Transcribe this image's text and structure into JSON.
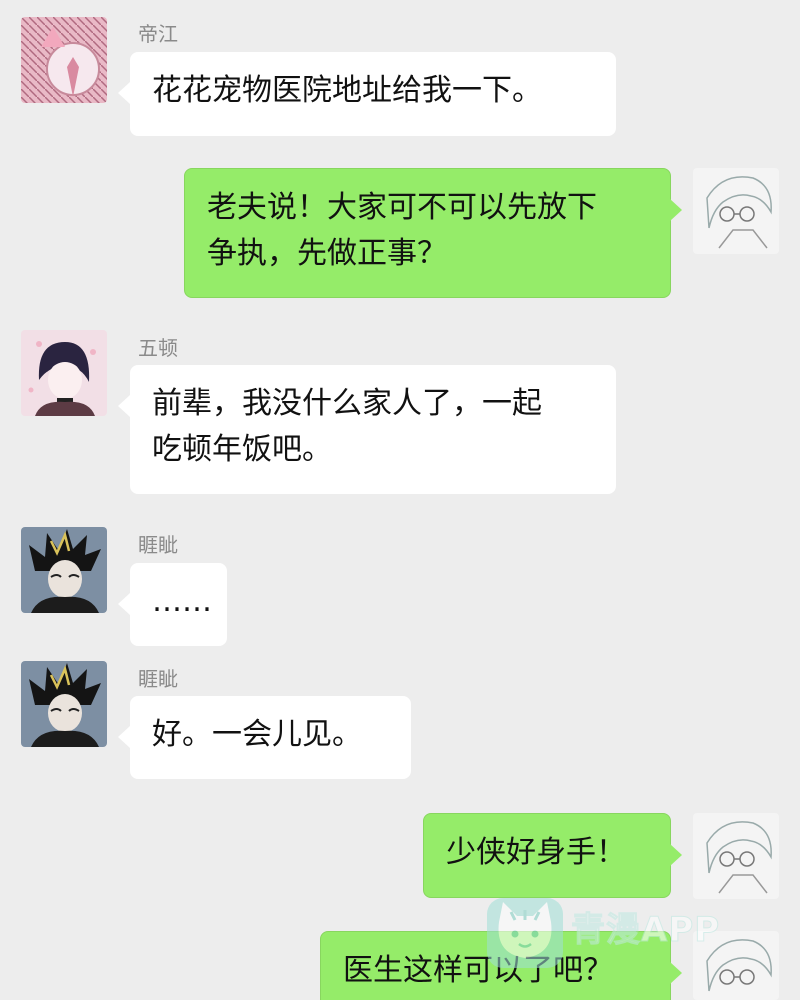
{
  "messages": [
    {
      "sender": "帝江",
      "text": "花花宠物医院地址给我一下。"
    },
    {
      "sender": "",
      "text": "老夫说！大家可不可以先放下\n争执，先做正事？"
    },
    {
      "sender": "五顿",
      "text": "前辈，我没什么家人了，一起\n吃顿年饭吧。"
    },
    {
      "sender": "睚眦",
      "text": "……"
    },
    {
      "sender": "睚眦",
      "text": "好。一会儿见。"
    },
    {
      "sender": "",
      "text": "少侠好身手！"
    },
    {
      "sender": "",
      "text": "医生这样可以了吧？"
    }
  ],
  "watermark": {
    "text": "青漫APP"
  },
  "colors": {
    "background": "#ededed",
    "incoming_bubble": "#ffffff",
    "outgoing_bubble": "#95ec69",
    "sender_name": "#8a8a8a"
  },
  "icons": {
    "avatar_dijiang": "avatar-pink-character",
    "avatar_wudun": "avatar-dark-hair-character",
    "avatar_yazi": "avatar-spiky-hair-character",
    "avatar_self": "avatar-sketch-character",
    "watermark_logo": "cat-logo-icon"
  }
}
